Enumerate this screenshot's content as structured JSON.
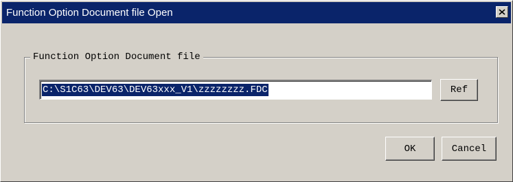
{
  "window": {
    "title": "Function Option Document file Open",
    "close_icon": "close-icon"
  },
  "group": {
    "label": "Function Option Document file"
  },
  "file_field": {
    "value": "C:\\S1C63\\DEV63\\DEV63xxx_V1\\zzzzzzzz.FDC",
    "selected": true
  },
  "buttons": {
    "ref": "Ref",
    "ok": "OK",
    "cancel": "Cancel"
  },
  "colors": {
    "titlebar": "#0a246a",
    "face": "#d4d0c8",
    "selection": "#0a246a"
  }
}
